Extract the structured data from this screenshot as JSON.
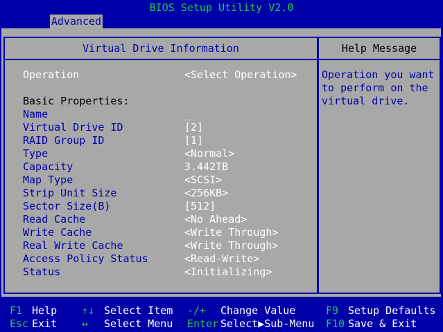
{
  "title": "BIOS Setup Utility V2.0",
  "tab": "Advanced",
  "main": {
    "heading": "Virtual Drive Information",
    "operation": {
      "label": "Operation",
      "value": "<Select Operation>"
    },
    "section_label": "Basic Properties:",
    "rows": [
      {
        "label": "Name",
        "value": "_"
      },
      {
        "label": "Virtual Drive ID",
        "value": "[2]"
      },
      {
        "label": "RAID Group ID",
        "value": "[1]"
      },
      {
        "label": "Type",
        "value": "<Normal>"
      },
      {
        "label": "Capacity",
        "value": "3.442TB"
      },
      {
        "label": "Map Type",
        "value": "<SCSI>"
      },
      {
        "label": "Strip Unit Size",
        "value": "<256KB>"
      },
      {
        "label": "Sector Size(B)",
        "value": "[512]"
      },
      {
        "label": "Read Cache",
        "value": "<No Ahead>"
      },
      {
        "label": "Write Cache",
        "value": "<Write Through>"
      },
      {
        "label": "Real Write Cache",
        "value": "<Write Through>"
      },
      {
        "label": "Access Policy Status",
        "value": "<Read-Write>"
      },
      {
        "label": "Status",
        "value": "<Initializing>"
      }
    ]
  },
  "help": {
    "heading": "Help Message",
    "lines": [
      "Operation you want",
      "to perform on the",
      "virtual drive."
    ]
  },
  "footer": {
    "items": [
      {
        "key": "F1",
        "desc": "Help"
      },
      {
        "key": "Esc",
        "desc": "Exit"
      },
      {
        "key": "↑↓",
        "desc": "Select Item"
      },
      {
        "key": "↔",
        "desc": "Select Menu"
      },
      {
        "key": "-/+",
        "desc": "Change Value"
      },
      {
        "key": "Enter",
        "desc": "Select▶Sub-Menu"
      },
      {
        "key": "F9",
        "desc": "Setup Defaults"
      },
      {
        "key": "F10",
        "desc": "Save & Exit"
      }
    ]
  },
  "colors": {
    "background": "#0000a8",
    "panel": "#a8a8a8",
    "accent": "#22cc44",
    "text_light": "#ffffff"
  }
}
